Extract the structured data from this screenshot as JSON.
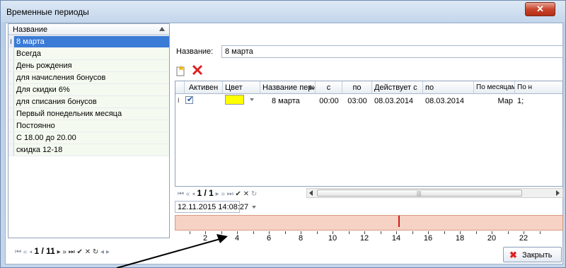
{
  "window": {
    "title": "Временные периоды"
  },
  "left_list": {
    "header": "Название",
    "items": [
      "8 марта",
      "Всегда",
      "День рождения",
      "для начисления бонусов",
      "Для скидки 6%",
      "для списания бонусов",
      "Первый понедельник месяца",
      "Постоянно",
      "С 18.00 до 20.00",
      "скидка 12-18"
    ],
    "selected_index": 0,
    "selected_marker": "I",
    "navigator": {
      "position": "1 / 11"
    }
  },
  "detail": {
    "name_label": "Название:",
    "name_value": "8 марта"
  },
  "periods_grid": {
    "columns": [
      "Активен",
      "Цвет",
      "Название период",
      "с",
      "по",
      "Действует с",
      "по",
      "По месяцам",
      "По н"
    ],
    "row": {
      "marker": "I",
      "active": true,
      "color": "#ffff00",
      "name": "8 марта",
      "from": "00:00",
      "to": "03:00",
      "valid_from": "08.03.2014",
      "valid_to": "08.03.2014",
      "by_months": "Мар",
      "by_n": "1;"
    },
    "navigator": {
      "position": "1 / 1"
    }
  },
  "timeline": {
    "datetime": "12.11.2015 14:08:27",
    "marker_hour": 14.1,
    "tick_labels": [
      "2",
      "4",
      "6",
      "8",
      "10",
      "12",
      "14",
      "16",
      "18",
      "20",
      "22"
    ]
  },
  "footer": {
    "close_label": "Закрыть"
  },
  "icons": {
    "add": "add-icon",
    "delete": "delete-icon",
    "trash": "trash-icon",
    "close": "close-icon"
  },
  "colors": {
    "selection": "#3a7bd5",
    "timeline_bg": "#f5d2c4",
    "marker": "#d31a1a",
    "delete_x": "#e02020"
  }
}
